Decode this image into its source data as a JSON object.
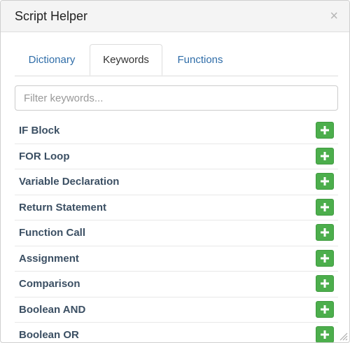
{
  "dialog": {
    "title": "Script Helper",
    "close_label": "×"
  },
  "tabs": [
    {
      "label": "Dictionary",
      "active": false
    },
    {
      "label": "Keywords",
      "active": true
    },
    {
      "label": "Functions",
      "active": false
    }
  ],
  "filter": {
    "placeholder": "Filter keywords...",
    "value": ""
  },
  "keywords": [
    {
      "label": "IF Block"
    },
    {
      "label": "FOR Loop"
    },
    {
      "label": "Variable Declaration"
    },
    {
      "label": "Return Statement"
    },
    {
      "label": "Function Call"
    },
    {
      "label": "Assignment"
    },
    {
      "label": "Comparison"
    },
    {
      "label": "Boolean AND"
    },
    {
      "label": "Boolean OR"
    }
  ],
  "colors": {
    "accent_link": "#2f6da8",
    "add_button": "#4cae4c",
    "keyword_text": "#3b4f63"
  },
  "icons": {
    "add": "plus-icon",
    "close": "close-icon",
    "resize": "resize-grip-icon"
  }
}
